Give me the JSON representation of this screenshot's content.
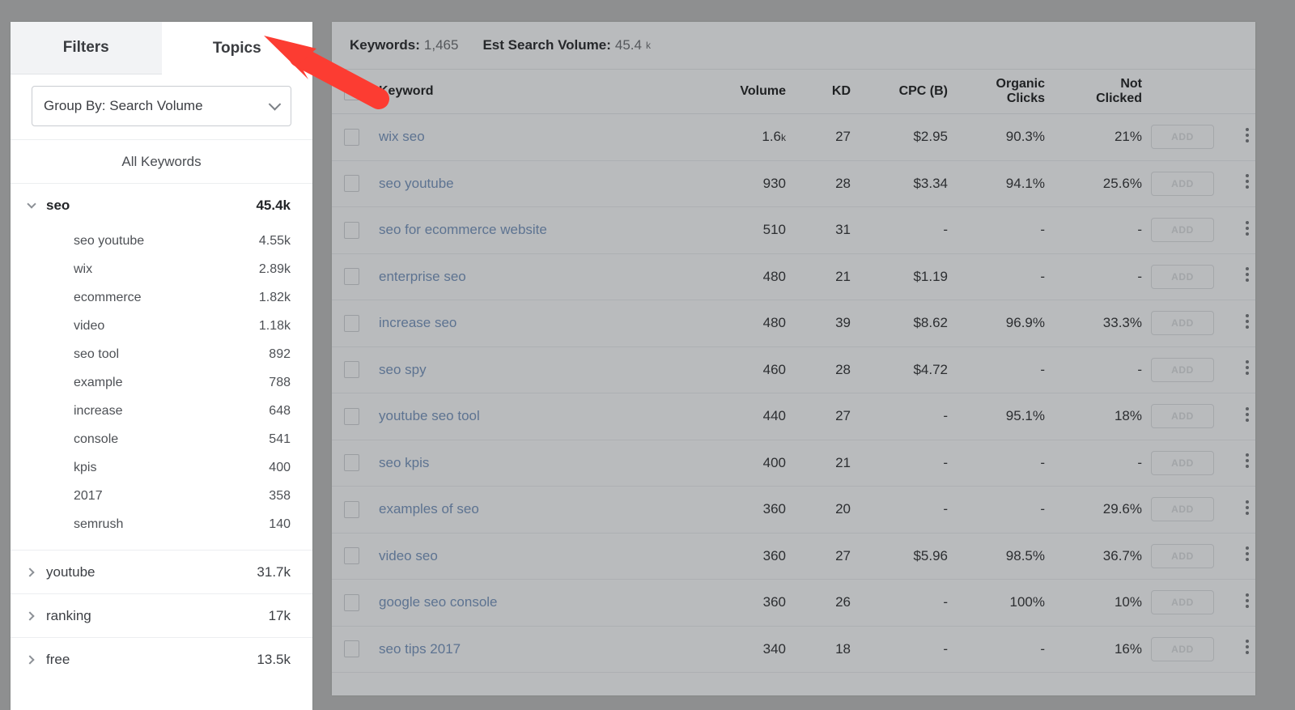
{
  "sidebar": {
    "tabs": [
      {
        "label": "Filters",
        "active": false
      },
      {
        "label": "Topics",
        "active": true
      }
    ],
    "group_by": {
      "label": "Group By: Search Volume"
    },
    "all_keywords_label": "All Keywords",
    "groups": [
      {
        "name": "seo",
        "value": "45.4k",
        "expanded": true,
        "children": [
          {
            "name": "seo youtube",
            "value": "4.55k"
          },
          {
            "name": "wix",
            "value": "2.89k"
          },
          {
            "name": "ecommerce",
            "value": "1.82k"
          },
          {
            "name": "video",
            "value": "1.18k"
          },
          {
            "name": "seo tool",
            "value": "892"
          },
          {
            "name": "example",
            "value": "788"
          },
          {
            "name": "increase",
            "value": "648"
          },
          {
            "name": "console",
            "value": "541"
          },
          {
            "name": "kpis",
            "value": "400"
          },
          {
            "name": "2017",
            "value": "358"
          },
          {
            "name": "semrush",
            "value": "140"
          }
        ]
      },
      {
        "name": "youtube",
        "value": "31.7k",
        "expanded": false,
        "children": []
      },
      {
        "name": "ranking",
        "value": "17k",
        "expanded": false,
        "children": []
      },
      {
        "name": "free",
        "value": "13.5k",
        "expanded": false,
        "children": []
      }
    ]
  },
  "main": {
    "summary": {
      "keywords_label": "Keywords:",
      "keywords_value": "1,465",
      "volume_label": "Est Search Volume:",
      "volume_value": "45.4",
      "volume_suffix": "k"
    },
    "columns": [
      "Keyword",
      "Volume",
      "KD",
      "CPC (B)",
      "Organic Clicks",
      "Not Clicked"
    ],
    "column_labels": {
      "keyword": "Keyword",
      "volume": "Volume",
      "kd": "KD",
      "cpc": "CPC (B)",
      "organic_line1": "Organic",
      "organic_line2": "Clicks",
      "not_line1": "Not",
      "not_line2": "Clicked"
    },
    "add_button_label": "ADD",
    "rows": [
      {
        "keyword": "wix seo",
        "volume": "1.6",
        "volume_suffix": "k",
        "kd": "27",
        "cpc": "$2.95",
        "organic": "90.3%",
        "not_clicked": "21%"
      },
      {
        "keyword": "seo youtube",
        "volume": "930",
        "volume_suffix": "",
        "kd": "28",
        "cpc": "$3.34",
        "organic": "94.1%",
        "not_clicked": "25.6%"
      },
      {
        "keyword": "seo for ecommerce website",
        "volume": "510",
        "volume_suffix": "",
        "kd": "31",
        "cpc": "-",
        "organic": "-",
        "not_clicked": "-"
      },
      {
        "keyword": "enterprise seo",
        "volume": "480",
        "volume_suffix": "",
        "kd": "21",
        "cpc": "$1.19",
        "organic": "-",
        "not_clicked": "-"
      },
      {
        "keyword": "increase seo",
        "volume": "480",
        "volume_suffix": "",
        "kd": "39",
        "cpc": "$8.62",
        "organic": "96.9%",
        "not_clicked": "33.3%"
      },
      {
        "keyword": "seo spy",
        "volume": "460",
        "volume_suffix": "",
        "kd": "28",
        "cpc": "$4.72",
        "organic": "-",
        "not_clicked": "-"
      },
      {
        "keyword": "youtube seo tool",
        "volume": "440",
        "volume_suffix": "",
        "kd": "27",
        "cpc": "-",
        "organic": "95.1%",
        "not_clicked": "18%"
      },
      {
        "keyword": "seo kpis",
        "volume": "400",
        "volume_suffix": "",
        "kd": "21",
        "cpc": "-",
        "organic": "-",
        "not_clicked": "-"
      },
      {
        "keyword": "examples of seo",
        "volume": "360",
        "volume_suffix": "",
        "kd": "20",
        "cpc": "-",
        "organic": "-",
        "not_clicked": "29.6%"
      },
      {
        "keyword": "video seo",
        "volume": "360",
        "volume_suffix": "",
        "kd": "27",
        "cpc": "$5.96",
        "organic": "98.5%",
        "not_clicked": "36.7%"
      },
      {
        "keyword": "google seo console",
        "volume": "360",
        "volume_suffix": "",
        "kd": "26",
        "cpc": "-",
        "organic": "100%",
        "not_clicked": "10%"
      },
      {
        "keyword": "seo tips 2017",
        "volume": "340",
        "volume_suffix": "",
        "kd": "18",
        "cpc": "-",
        "organic": "-",
        "not_clicked": "16%"
      }
    ]
  },
  "annotation": {
    "type": "arrow",
    "color": "#fc3c32",
    "points_to": "Topics"
  }
}
